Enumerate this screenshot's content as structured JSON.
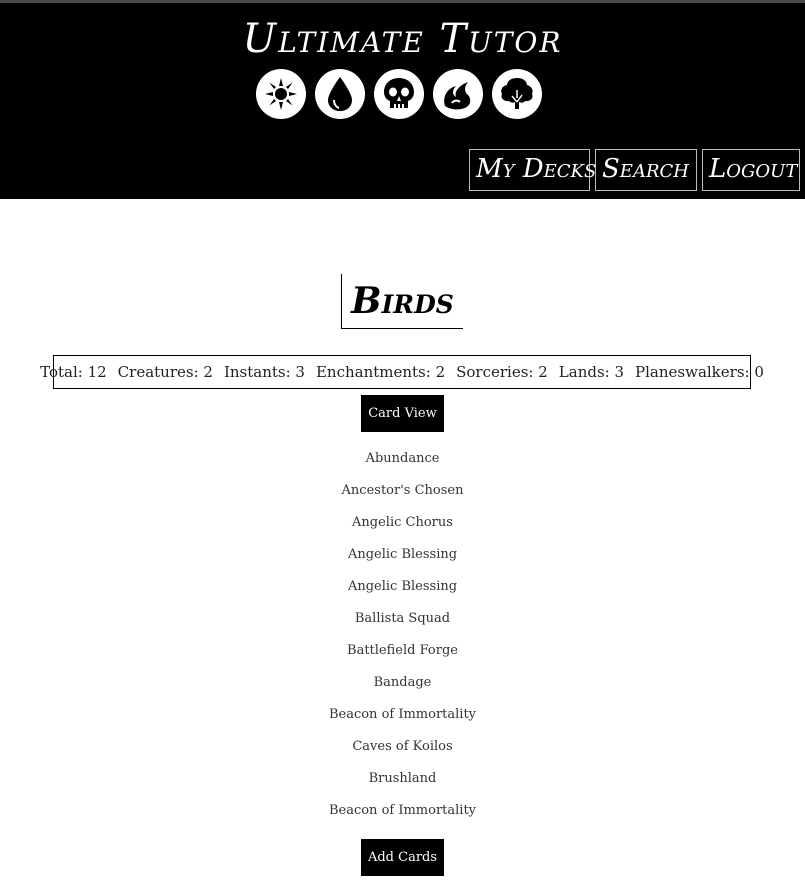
{
  "header": {
    "site_title": "Ultimate Tutor",
    "mana_icons": [
      "white-sun-icon",
      "blue-drop-icon",
      "black-skull-icon",
      "red-fire-icon",
      "green-tree-icon"
    ],
    "nav": {
      "my_decks": "My Decks",
      "search": "Search",
      "logout": "Logout"
    }
  },
  "deck": {
    "title": "Birds",
    "stats": [
      "Total: 12",
      "Creatures: 2",
      "Instants: 3",
      "Enchantments: 2",
      "Sorceries: 2",
      "Lands: 3",
      "Planeswalkers: 0"
    ],
    "card_view_label": "Card View",
    "cards": [
      "Abundance",
      "Ancestor's Chosen",
      "Angelic Chorus",
      "Angelic Blessing",
      "Angelic Blessing",
      "Ballista Squad",
      "Battlefield Forge",
      "Bandage",
      "Beacon of Immortality",
      "Caves of Koilos",
      "Brushland",
      "Beacon of Immortality"
    ],
    "add_cards_label": "Add Cards"
  },
  "colors": {
    "header_bg": "#000000",
    "page_bg": "#ffffff",
    "button_bg": "#000000"
  }
}
